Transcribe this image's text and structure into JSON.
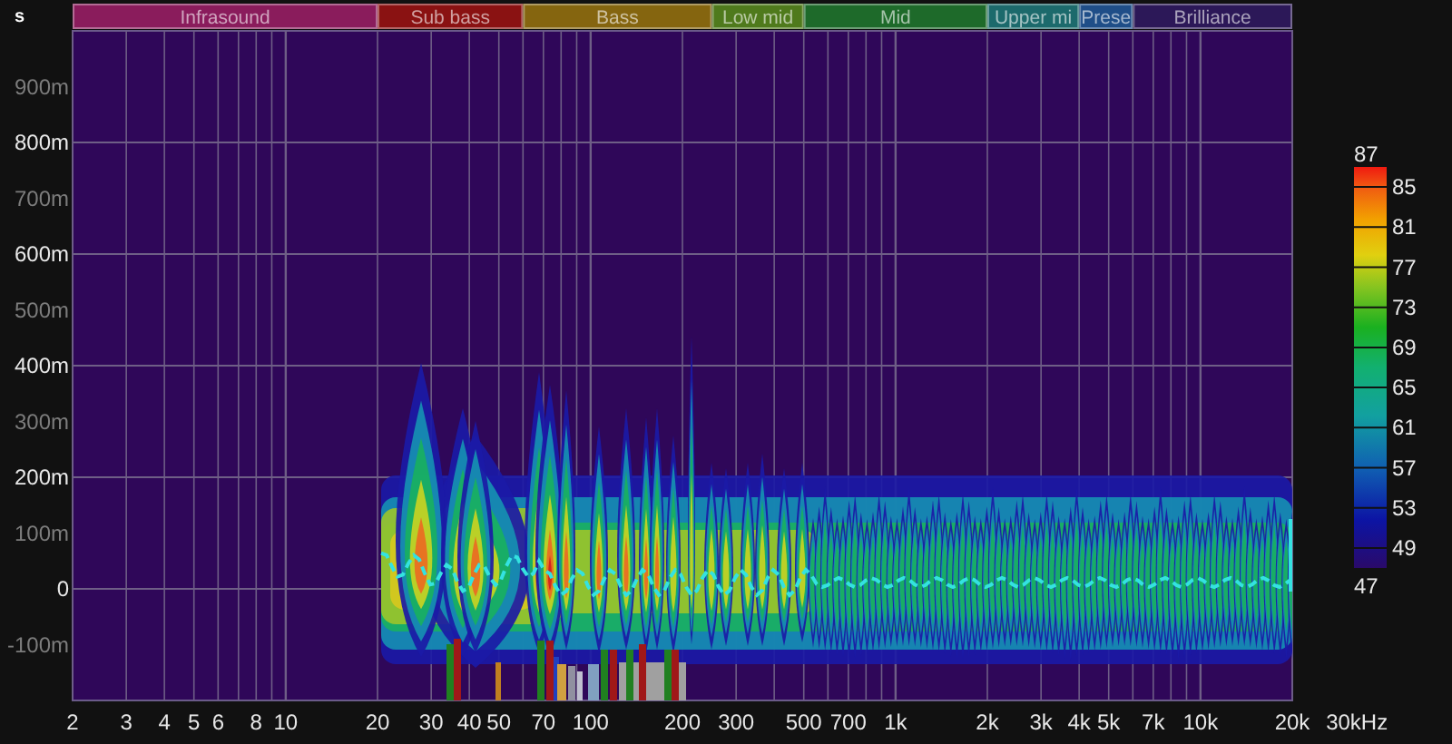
{
  "band_bar": {
    "label": "s",
    "bands": [
      {
        "label": "Infrasound",
        "color": "#8a1c5c"
      },
      {
        "label": "Sub bass",
        "color": "#8a1212"
      },
      {
        "label": "Bass",
        "color": "#85650f"
      },
      {
        "label": "Low mid",
        "color": "#4f7a1c"
      },
      {
        "label": "Mid",
        "color": "#1e6a2a"
      },
      {
        "label": "Upper mi",
        "color": "#1c6a6c"
      },
      {
        "label": "Prese",
        "color": "#1f4e88"
      },
      {
        "label": "Brilliance",
        "color": "#2c1858"
      }
    ]
  },
  "y_axis": {
    "ticks": [
      {
        "label": "900m",
        "major": false
      },
      {
        "label": "800m",
        "major": true
      },
      {
        "label": "700m",
        "major": false
      },
      {
        "label": "600m",
        "major": true
      },
      {
        "label": "500m",
        "major": false
      },
      {
        "label": "400m",
        "major": true
      },
      {
        "label": "300m",
        "major": false
      },
      {
        "label": "200m",
        "major": true
      },
      {
        "label": "100m",
        "major": false
      },
      {
        "label": "0",
        "major": true
      },
      {
        "label": "-100m",
        "major": false
      }
    ]
  },
  "x_axis": {
    "ticks": [
      "2",
      "3",
      "4",
      "5",
      "6",
      "8",
      "10",
      "20",
      "30",
      "40",
      "50",
      "70",
      "100",
      "200",
      "300",
      "500",
      "700",
      "1k",
      "2k",
      "3k",
      "4k",
      "5k",
      "7k",
      "10k",
      "20k",
      "30kHz"
    ]
  },
  "color_scale": {
    "labels": [
      "87",
      "85",
      "81",
      "77",
      "73",
      "69",
      "65",
      "61",
      "57",
      "53",
      "49",
      "47"
    ]
  }
}
